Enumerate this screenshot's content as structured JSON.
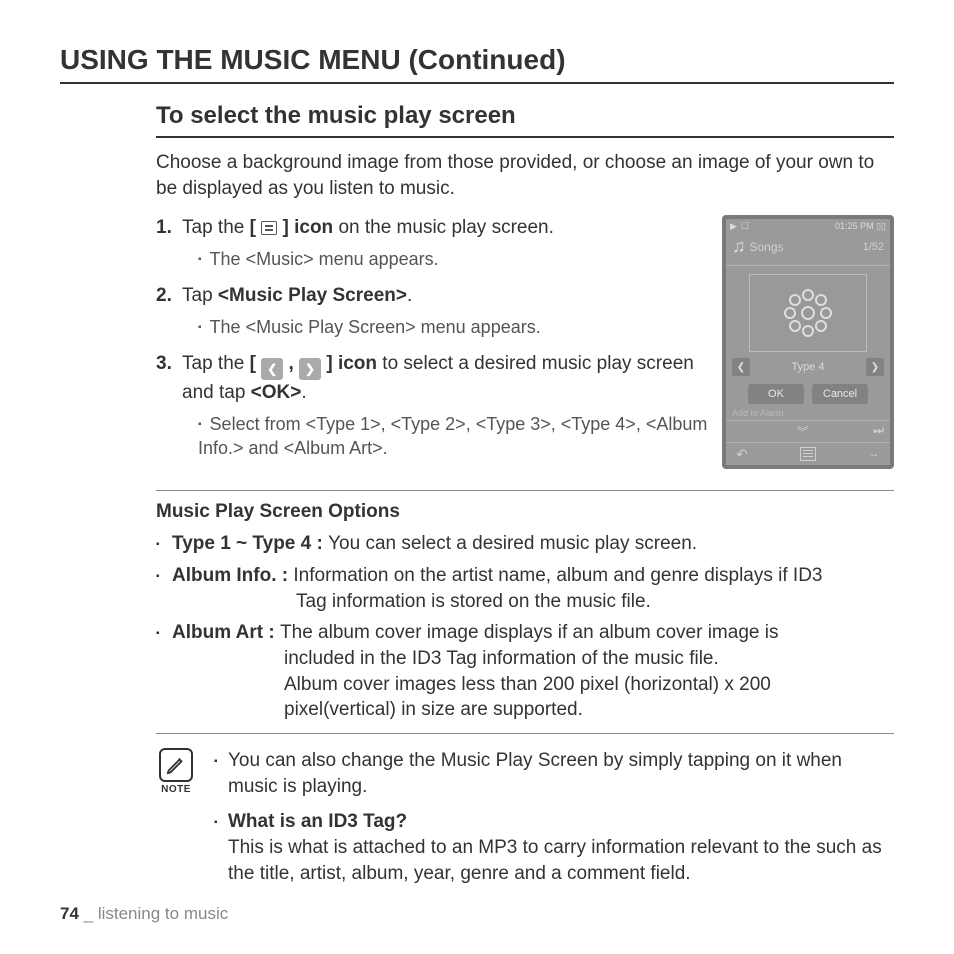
{
  "page": {
    "title": "USING THE MUSIC MENU (Continued)",
    "section_title": "To select the music play screen",
    "intro": "Choose a background image from those provided, or choose an image of your own to be displayed as you listen to music.",
    "options_heading": "Music Play Screen Options",
    "page_number": "74",
    "footer_sep": " _ ",
    "footer_section": "listening to music"
  },
  "steps": {
    "s1_a": "Tap the ",
    "s1_b": "[",
    "s1_c": "] icon",
    "s1_d": " on the music play screen.",
    "s1_sub": "The <Music> menu appears.",
    "s2_a": "Tap ",
    "s2_b": "<Music Play Screen>",
    "s2_c": ".",
    "s2_sub": "The <Music Play Screen> menu appears.",
    "s3_a": "Tap the ",
    "s3_b": "[ ",
    "s3_comma": " , ",
    "s3_c": " ] ",
    "s3_icon": "icon",
    "s3_d": " to select a desired music play screen and tap ",
    "s3_e": "<OK>",
    "s3_f": ".",
    "s3_sub": "Select from <Type 1>, <Type 2>, <Type 3>, <Type 4>, <Album Info.> and <Album Art>."
  },
  "options": {
    "o1_label": "Type 1 ~ Type 4 : ",
    "o1_text": "You can select a desired music play screen.",
    "o2_label": "Album Info. : ",
    "o2_text1": "Information on the artist name, album and genre displays if ID3",
    "o2_text2": "Tag information is stored on the music file.",
    "o3_label": "Album Art : ",
    "o3_text1": "The album cover image displays if an album cover image is",
    "o3_text2": "included in the ID3 Tag information of the music file.",
    "o3_text3": "Album cover images less than 200 pixel (horizontal) x 200",
    "o3_text4": "pixel(vertical) in size are supported."
  },
  "note": {
    "label": "NOTE",
    "n1": "You can also change the Music Play Screen by simply tapping on it when music is playing.",
    "n2_title": "What is an ID3 Tag?",
    "n2_body": "This is what is attached to an MP3 to carry information relevant to the such as the title, artist, album, year, genre and a comment field."
  },
  "device": {
    "time": "01:25 PM",
    "songs": "Songs",
    "counter": "1/52",
    "type_label": "Type 4",
    "ok": "OK",
    "cancel": "Cancel",
    "add_alarm": "Add to Alarm"
  }
}
